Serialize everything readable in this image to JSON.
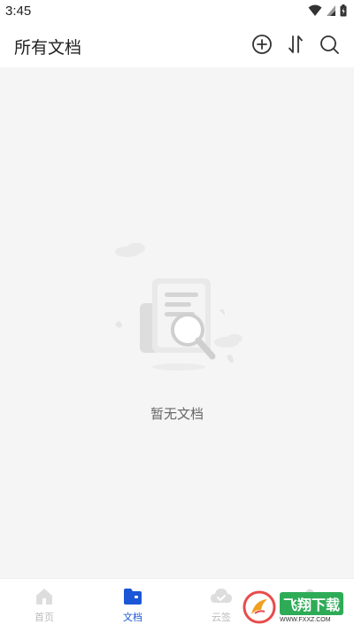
{
  "status_bar": {
    "time": "3:45",
    "icons": [
      "wifi-icon",
      "signal-icon",
      "battery-icon"
    ]
  },
  "header": {
    "title": "所有文档",
    "actions": [
      "add-circle-icon",
      "sort-icon",
      "search-icon"
    ]
  },
  "empty_state": {
    "text": "暂无文档",
    "illustration": "document-search-icon"
  },
  "bottom_nav": {
    "items": [
      {
        "label": "首页",
        "icon": "home-icon",
        "active": false
      },
      {
        "label": "文档",
        "icon": "folder-icon",
        "active": true
      },
      {
        "label": "云签",
        "icon": "cloud-icon",
        "active": false
      },
      {
        "label": "",
        "icon": "profile-icon",
        "active": false
      }
    ]
  },
  "watermark": {
    "text": "飞翔下载",
    "url": "WWW.FXXZ.COM"
  },
  "colors": {
    "accent": "#1a56d6",
    "inactive": "#bbbbbb",
    "content_background": "#f5f5f5"
  }
}
